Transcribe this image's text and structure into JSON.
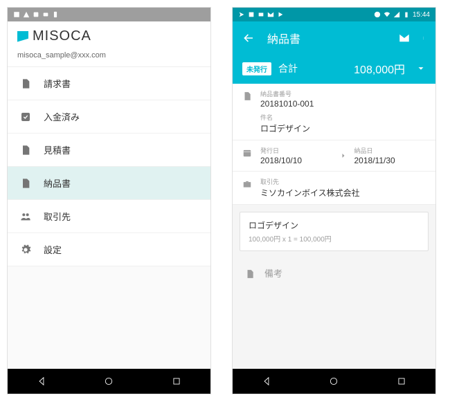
{
  "left": {
    "brand": "MISOCA",
    "email": "misoca_sample@xxx.com",
    "menu": [
      {
        "label": "請求書",
        "icon": "file-icon"
      },
      {
        "label": "入金済み",
        "icon": "check-icon"
      },
      {
        "label": "見積書",
        "icon": "file-icon"
      },
      {
        "label": "納品書",
        "icon": "file-icon",
        "selected": true
      },
      {
        "label": "取引先",
        "icon": "people-icon"
      },
      {
        "label": "設定",
        "icon": "gear-icon"
      }
    ]
  },
  "right": {
    "status_time": "15:44",
    "title": "納品書",
    "badge": "未発行",
    "total_label": "合計",
    "total_amount": "108,000円",
    "doc_number_label": "納品書番号",
    "doc_number": "20181010-001",
    "subject_label": "件名",
    "subject": "ロゴデザイン",
    "issue_date_label": "発行日",
    "issue_date": "2018/10/10",
    "delivery_date_label": "納品日",
    "delivery_date": "2018/11/30",
    "client_label": "取引先",
    "client": "ミソカインボイス株式会社",
    "item_name": "ロゴデザイン",
    "item_calc": "100,000円 x 1 = 100,000円",
    "note_label": "備考"
  }
}
